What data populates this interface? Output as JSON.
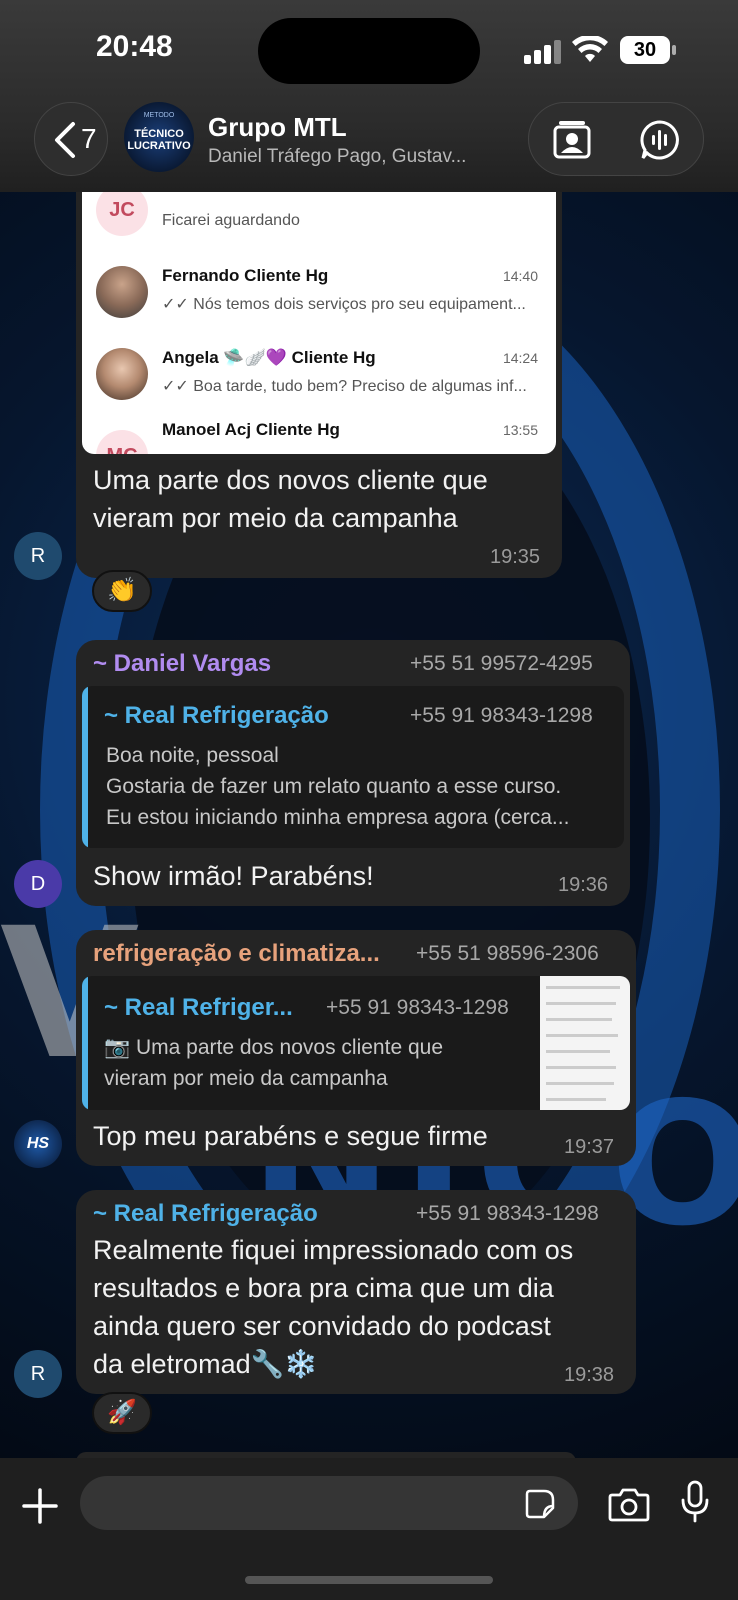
{
  "status_bar": {
    "time": "20:48",
    "battery": "30"
  },
  "header": {
    "back_count": "7",
    "group_name": "Grupo MTL",
    "group_members": "Daniel Tráfego Pago, Gustav...",
    "avatar_text": "TÉCNICO LUCRATIVO",
    "avatar_subtext": "METODO"
  },
  "image_preview": {
    "rows": [
      {
        "initials": "JC",
        "name": "",
        "time": "",
        "preview": "Ficarei aguardando"
      },
      {
        "initials": "",
        "name": "Fernando Cliente Hg",
        "time": "14:40",
        "preview": "✓✓ Nós temos dois serviços pro seu equipament..."
      },
      {
        "initials": "",
        "name": "Angela 🛸🪽💜 Cliente Hg",
        "time": "14:24",
        "preview": "✓✓ Boa tarde, tudo bem? Preciso de algumas inf..."
      },
      {
        "initials": "MC",
        "name": "Manoel Acj Cliente Hg",
        "time": "13:55",
        "preview": ""
      }
    ]
  },
  "messages": [
    {
      "avatar": "R",
      "text_lines": [
        "Uma parte dos novos cliente que",
        "vieram por meio da campanha"
      ],
      "time": "19:35",
      "reaction": "👏"
    },
    {
      "avatar": "D",
      "sender": "~ Daniel Vargas",
      "phone": "+55 51 99572-4295",
      "quote": {
        "sender": "~ Real Refrigeração",
        "phone": "+55 91 98343-1298",
        "lines": [
          "Boa noite, pessoal",
          "Gostaria de fazer um relato quanto a esse curso.",
          "Eu estou iniciando minha empresa agora (cerca..."
        ]
      },
      "text": "Show irmão! Parabéns!",
      "time": "19:36"
    },
    {
      "avatar": "HS",
      "sender": "refrigeração e climatiza...",
      "phone": "+55 51 98596-2306",
      "quote": {
        "sender": "~ Real Refriger...",
        "phone": "+55 91 98343-1298",
        "lines": [
          "📷 Uma parte dos novos cliente que",
          "vieram por meio da campanha"
        ]
      },
      "text": "Top meu parabéns e segue firme",
      "time": "19:37"
    },
    {
      "avatar": "R",
      "sender": "~ Real Refrigeração",
      "phone": "+55 91 98343-1298",
      "text_lines": [
        "Realmente fiquei impressionado com os",
        "resultados e bora pra cima que um dia",
        "ainda quero ser convidado do podcast",
        "da eletromad🔧❄️"
      ],
      "time": "19:38",
      "reaction": "🚀"
    }
  ],
  "composer": {
    "placeholder": ""
  },
  "colors": {
    "accent_blue": "#4fb2e8",
    "daniel": "#b18cf0",
    "refrig": "#e7a27c",
    "real": "#4fb2e8"
  }
}
